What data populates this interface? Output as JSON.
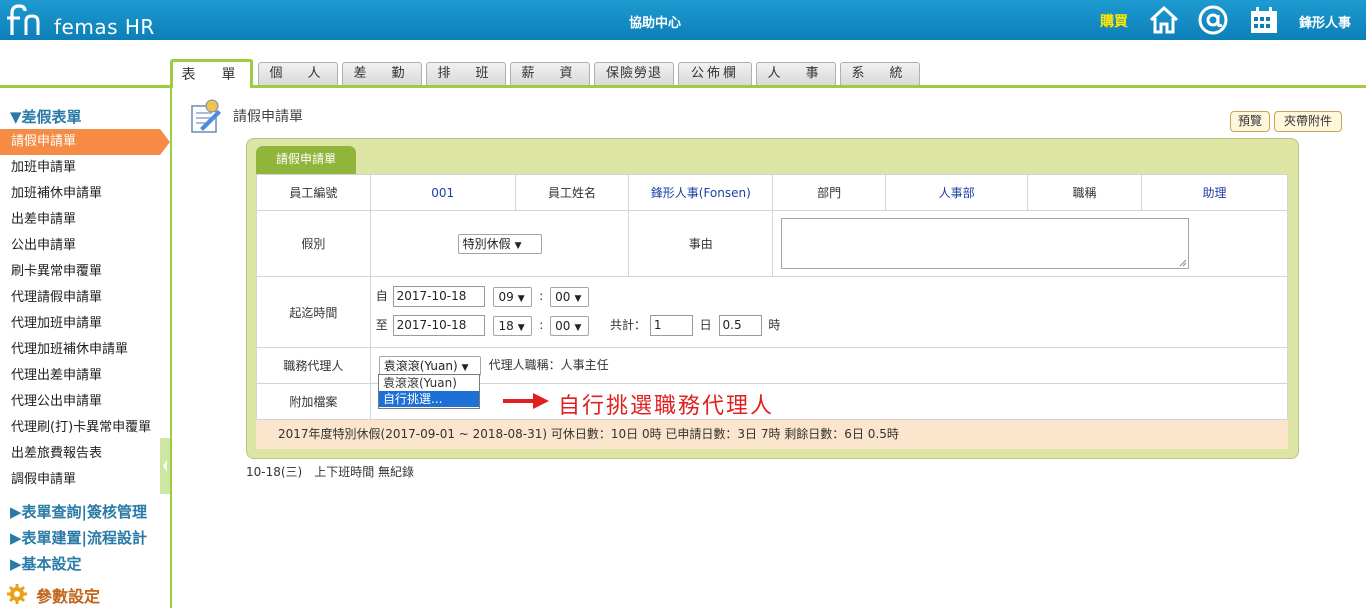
{
  "header": {
    "logo_text": "femas HR",
    "help_center": "協助中心",
    "buy": "購買",
    "icons": [
      "home-icon",
      "at-icon",
      "calendar-icon"
    ],
    "user": "鋒形人事"
  },
  "tabs": [
    {
      "label": "表　單",
      "active": true
    },
    {
      "label": "個　人"
    },
    {
      "label": "差　勤"
    },
    {
      "label": "排　班"
    },
    {
      "label": "薪　資"
    },
    {
      "label": "保險勞退"
    },
    {
      "label": "公佈欄"
    },
    {
      "label": "人　事"
    },
    {
      "label": "系　統"
    }
  ],
  "sidebar": {
    "section_main": "▼差假表單",
    "items": [
      {
        "label": "請假申請單",
        "active": true
      },
      {
        "label": "加班申請單"
      },
      {
        "label": "加班補休申請單"
      },
      {
        "label": "出差申請單"
      },
      {
        "label": "公出申請單"
      },
      {
        "label": "刷卡異常申覆單"
      },
      {
        "label": "代理請假申請單"
      },
      {
        "label": "代理加班申請單"
      },
      {
        "label": "代理加班補休申請單"
      },
      {
        "label": "代理出差申請單"
      },
      {
        "label": "代理公出申請單"
      },
      {
        "label": "代理刷(打)卡異常申覆單"
      },
      {
        "label": "出差旅費報告表"
      },
      {
        "label": "調假申請單"
      }
    ],
    "sections": [
      "▶表單查詢|簽核管理",
      "▶表單建置|流程設計",
      "▶基本設定"
    ],
    "param": "參數設定"
  },
  "page": {
    "title": "請假申請單",
    "preview_button": "預覽",
    "attach_button": "夾帶附件",
    "form_tab": "請假申請單"
  },
  "form": {
    "emp_no_label": "員工編號",
    "emp_no": "001",
    "emp_name_label": "員工姓名",
    "emp_name": "鋒形人事(Fonsen)",
    "dept_label": "部門",
    "dept": "人事部",
    "title_label": "職稱",
    "title": "助理",
    "leave_type_label": "假別",
    "leave_type": "特別休假",
    "reason_label": "事由",
    "reason": "",
    "period_label": "起迄時間",
    "from_label": "自",
    "from_date": "2017-10-18",
    "from_hour": "09",
    "from_min": "00",
    "to_label": "至",
    "to_date": "2017-10-18",
    "to_hour": "18",
    "to_min": "00",
    "total_label": "共計：",
    "total_days": "1",
    "day_unit": "日",
    "total_hours": "0.5",
    "hour_unit": "時",
    "colon": ":",
    "agent_label": "職務代理人",
    "agent": "袁滾滾(Yuan)",
    "agent_title": "代理人職稱：人事主任",
    "agent_options": [
      "袁滾滾(Yuan)",
      "自行挑選..."
    ],
    "attach_label": "附加檔案",
    "summary": "2017年度特別休假(2017-09-01 ~ 2018-08-31)  可休日數：10日 0時  已申請日數：3日 7時  剩餘日數：6日 0.5時"
  },
  "annotation": "自行挑選職務代理人",
  "bottom_note": "10-18(三)　上下班時間 無紀錄",
  "colors": {
    "topbar": "#1590c8",
    "accent_green": "#9dcc3e",
    "active_orange": "#f58b45",
    "annotation_red": "#e02020"
  }
}
